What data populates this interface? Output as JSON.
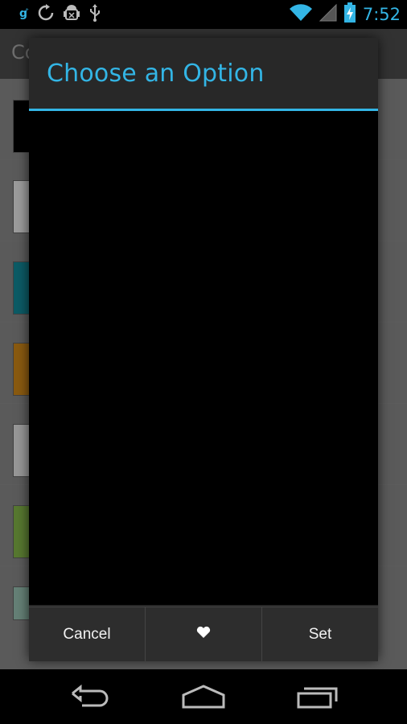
{
  "status_bar": {
    "time": "7:52",
    "icons": [
      "google-g-icon",
      "sync-icon",
      "android-debug-icon",
      "usb-icon",
      "wifi-icon",
      "signal-icon",
      "battery-charging-icon"
    ]
  },
  "app": {
    "title": "Co",
    "swatch_colors": [
      "#000000",
      "#f0f0f0",
      "#138d9b",
      "#d48a1a",
      "#e9e9e9",
      "#86b84a",
      "#9bc6b6"
    ]
  },
  "dialog": {
    "title": "Choose an Option",
    "buttons": {
      "cancel": "Cancel",
      "favorite_icon": "heart-icon",
      "set": "Set"
    }
  },
  "nav_bar": {
    "icons": [
      "back-icon",
      "home-icon",
      "recent-apps-icon"
    ]
  },
  "colors": {
    "accent": "#33b5e5",
    "dialog_bg": "#282828"
  }
}
